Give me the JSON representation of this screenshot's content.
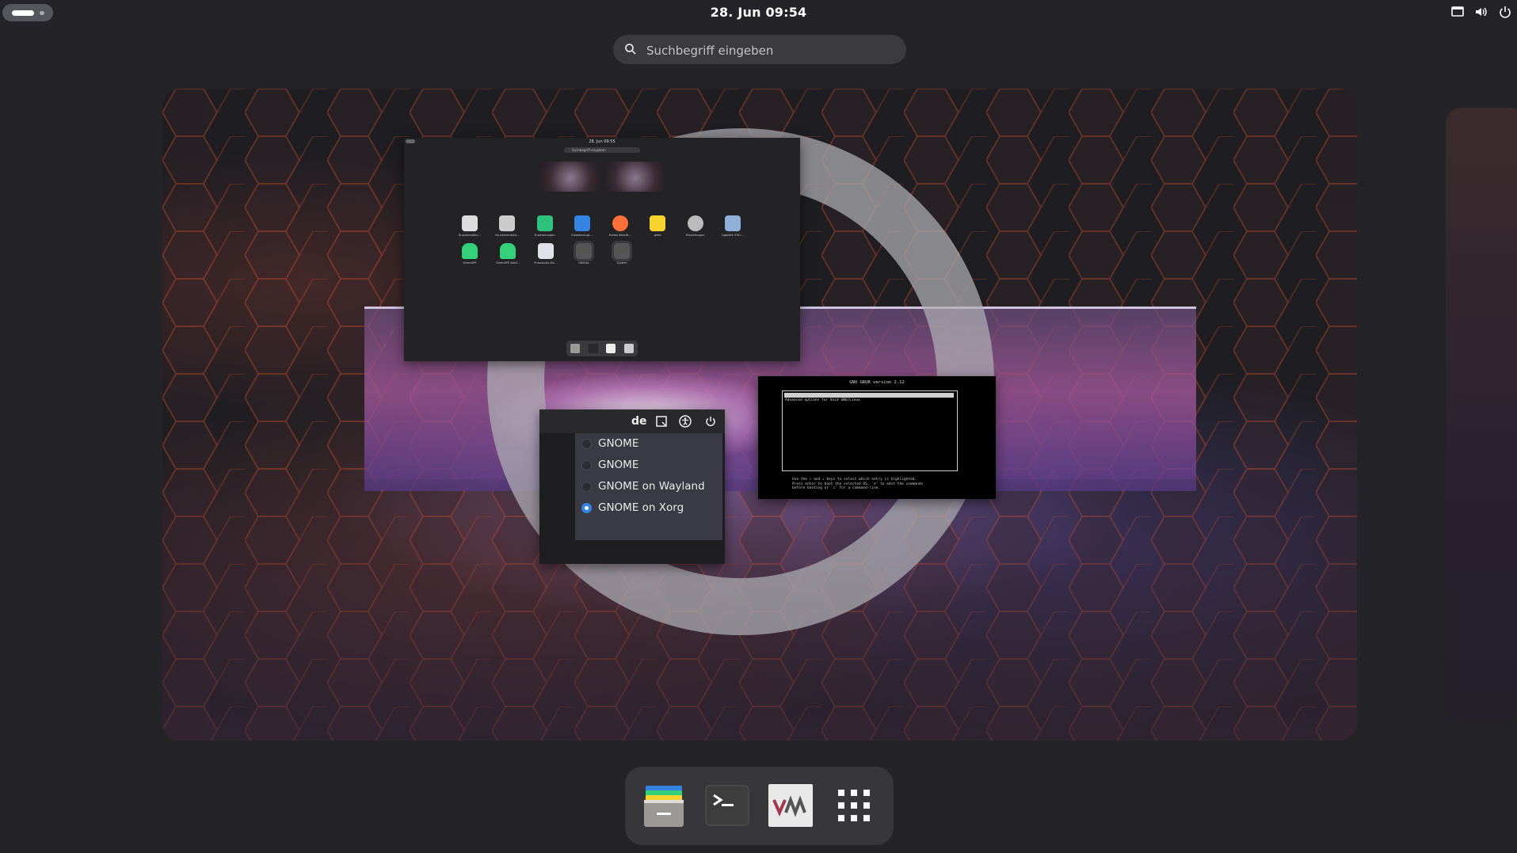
{
  "topbar": {
    "clock": "28. Jun  09:54",
    "tray_icons": [
      "screen-icon",
      "volume-icon",
      "power-icon"
    ]
  },
  "search": {
    "placeholder": "Suchbegriff eingeben"
  },
  "inner_screenshot": {
    "clock": "28. Jun 09:55",
    "search_placeholder": "Suchbegriff eingeben",
    "apps_row1": [
      "Druckeinstellu...",
      "Druckereinstell...",
      "Erweiterungen",
      "Erweiterungs-...",
      "Firefox Web Br...",
      "gedit",
      "Einstellungen",
      "LightDM GTK+..."
    ],
    "apps_row2": [
      "GreenSPE",
      "GreenSPE Notif...",
      "PulseAudio-Ein...",
      "Utilities",
      "System"
    ]
  },
  "session_menu": {
    "lang": "de",
    "options": [
      {
        "label": "GNOME",
        "selected": false
      },
      {
        "label": "GNOME",
        "selected": false
      },
      {
        "label": "GNOME on Wayland",
        "selected": false
      },
      {
        "label": "GNOME on Xorg",
        "selected": true
      }
    ]
  },
  "grub": {
    "title": "GNU GRUB  version 2.12",
    "entry": "Advanced options for Void GNU/Linux",
    "help": "Use the ↑ and ↓ keys to select which entry is highlighted.\nPress enter to boot the selected OS, `e' to edit the commands\nbefore booting or `c' for a command-line."
  },
  "dock": {
    "items": [
      "files-icon",
      "terminal-icon",
      "virt-manager-icon",
      "show-apps-icon"
    ]
  },
  "colors": {
    "accent": "#3584e4",
    "panel": "#242428",
    "dock": "#37373b"
  }
}
